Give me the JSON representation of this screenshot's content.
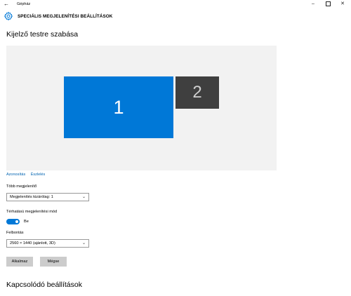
{
  "window": {
    "title": "Gépház",
    "back_glyph": "←",
    "minimize_glyph": "–",
    "close_glyph": "✕"
  },
  "header": {
    "icon": "gear-icon",
    "title": "SPECIÁLIS MEGJELENÍTÉSI BEÁLLÍTÁSOK"
  },
  "customize": {
    "heading": "Kijelző testre szabása",
    "monitors": [
      {
        "label": "1",
        "color": "#0078d7",
        "selected": true
      },
      {
        "label": "2",
        "color": "#3f3f3f",
        "selected": false
      }
    ],
    "links": {
      "identify": "Azonosítás",
      "detect": "Észlelés"
    }
  },
  "multiple_displays": {
    "label": "Több megjelenítő",
    "value": "Megjelenítés kizárólag: 1"
  },
  "hdr": {
    "label": "Térhatású megjelenítési mód",
    "state": "Be",
    "on": true
  },
  "resolution": {
    "label": "Felbontás",
    "value": "2560 × 1440 (ajánlott, 3D)"
  },
  "buttons": {
    "apply": "Alkalmaz",
    "cancel": "Mégse"
  },
  "related": {
    "heading": "Kapcsolódó beállítások"
  },
  "colors": {
    "accent": "#0078d7",
    "link": "#0063b1",
    "canvas_bg": "#f2f2f2",
    "button_bg": "#cccccc"
  }
}
